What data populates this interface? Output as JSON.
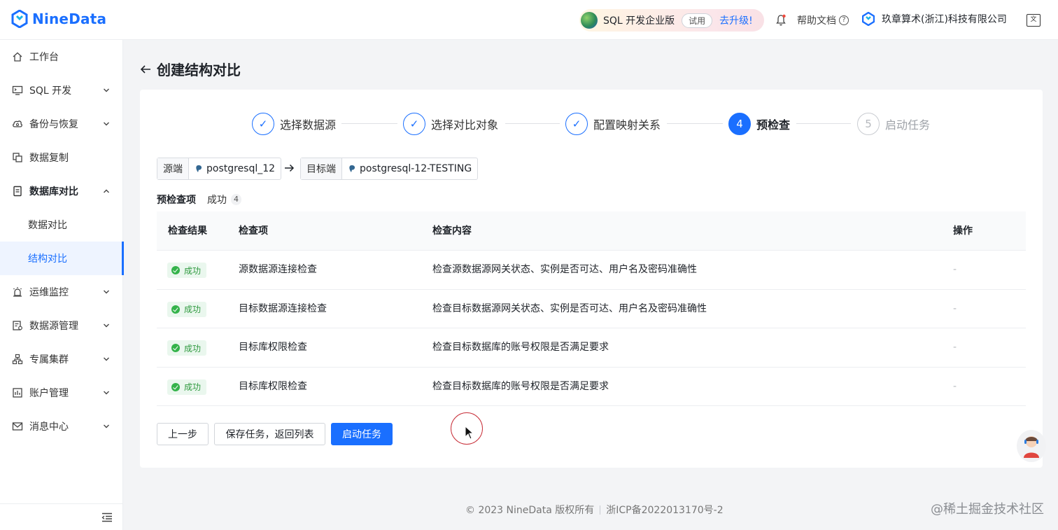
{
  "header": {
    "brand": "NineData",
    "promo_title": "SQL 开发企业版",
    "promo_trial": "试用",
    "promo_upgrade": "去升级!",
    "help_label": "帮助文档",
    "org_name": "玖章算术(浙江)科技有限公司",
    "lang_icon": "translate-icon"
  },
  "sidebar": {
    "items": [
      {
        "label": "工作台",
        "icon": "home-icon"
      },
      {
        "label": "SQL 开发",
        "icon": "monitor-icon"
      },
      {
        "label": "备份与恢复",
        "icon": "cloud-backup-icon"
      },
      {
        "label": "数据复制",
        "icon": "copy-data-icon"
      },
      {
        "label": "数据库对比",
        "icon": "compare-icon"
      },
      {
        "label": "数据对比"
      },
      {
        "label": "结构对比"
      },
      {
        "label": "运维监控",
        "icon": "alarm-icon"
      },
      {
        "label": "数据源管理",
        "icon": "database-icon"
      },
      {
        "label": "专属集群",
        "icon": "cluster-icon"
      },
      {
        "label": "账户管理",
        "icon": "account-icon"
      },
      {
        "label": "消息中心",
        "icon": "mail-icon"
      }
    ]
  },
  "page": {
    "title": "创建结构对比"
  },
  "steps": [
    {
      "index": "1",
      "label": "选择数据源",
      "status": "done"
    },
    {
      "index": "2",
      "label": "选择对比对象",
      "status": "done"
    },
    {
      "index": "3",
      "label": "配置映射关系",
      "status": "done"
    },
    {
      "index": "4",
      "label": "预检查",
      "status": "current"
    },
    {
      "index": "5",
      "label": "启动任务",
      "status": "pending"
    }
  ],
  "source": {
    "tag": "源端",
    "name": "postgresql_12"
  },
  "target": {
    "tag": "目标端",
    "name": "postgresql-12-TESTING"
  },
  "precheck": {
    "title": "预检查项",
    "status": "成功",
    "count": "4"
  },
  "table": {
    "headers": [
      "检查结果",
      "检查项",
      "检查内容",
      "操作"
    ],
    "rows": [
      {
        "result": "成功",
        "item": "源数据源连接检查",
        "content": "检查源数据源网关状态、实例是否可达、用户名及密码准确性",
        "action": "-"
      },
      {
        "result": "成功",
        "item": "目标数据源连接检查",
        "content": "检查目标数据源网关状态、实例是否可达、用户名及密码准确性",
        "action": "-"
      },
      {
        "result": "成功",
        "item": "目标库权限检查",
        "content": "检查目标数据库的账号权限是否满足要求",
        "action": "-"
      },
      {
        "result": "成功",
        "item": "目标库权限检查",
        "content": "检查目标数据库的账号权限是否满足要求",
        "action": "-"
      }
    ]
  },
  "buttons": {
    "prev": "上一步",
    "save": "保存任务，返回列表",
    "start": "启动任务"
  },
  "footer": {
    "copyright": "© 2023 NineData 版权所有",
    "icp": "浙ICP备2022013170号-2"
  },
  "watermark": "@稀土掘金技术社区",
  "colors": {
    "accent": "#1a6fff",
    "success": "#34b34a"
  }
}
